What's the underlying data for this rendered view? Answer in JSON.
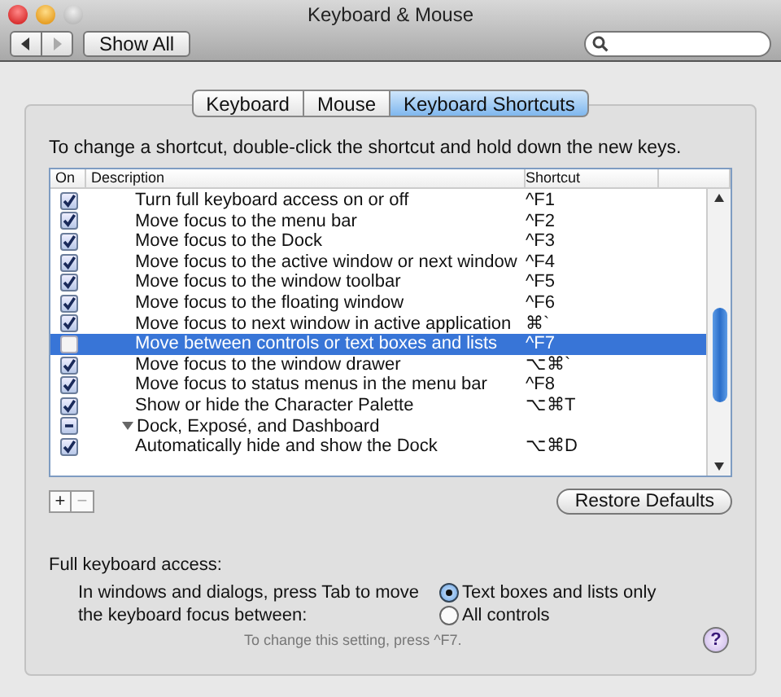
{
  "window": {
    "title": "Keyboard & Mouse"
  },
  "toolbar": {
    "show_all": "Show All"
  },
  "tabs": [
    {
      "label": "Keyboard",
      "selected": false
    },
    {
      "label": "Mouse",
      "selected": false
    },
    {
      "label": "Keyboard Shortcuts",
      "selected": true
    }
  ],
  "instruction": "To change a shortcut, double-click the shortcut and hold down the new keys.",
  "table": {
    "columns": [
      "On",
      "Description",
      "Shortcut"
    ],
    "rows": [
      {
        "kind": "item",
        "checked": true,
        "description": "Turn full keyboard access on or off",
        "shortcut": "^F1",
        "selected": false
      },
      {
        "kind": "item",
        "checked": true,
        "description": "Move focus to the menu bar",
        "shortcut": "^F2",
        "selected": false
      },
      {
        "kind": "item",
        "checked": true,
        "description": "Move focus to the Dock",
        "shortcut": "^F3",
        "selected": false
      },
      {
        "kind": "item",
        "checked": true,
        "description": "Move focus to the active window or next window",
        "shortcut": "^F4",
        "selected": false
      },
      {
        "kind": "item",
        "checked": true,
        "description": "Move focus to the window toolbar",
        "shortcut": "^F5",
        "selected": false
      },
      {
        "kind": "item",
        "checked": true,
        "description": "Move focus to the floating window",
        "shortcut": "^F6",
        "selected": false
      },
      {
        "kind": "item",
        "checked": true,
        "description": "Move focus to next window in active application",
        "shortcut": "⌘`",
        "selected": false
      },
      {
        "kind": "item",
        "checked": false,
        "description": "Move between controls or text boxes and lists",
        "shortcut": "^F7",
        "selected": true
      },
      {
        "kind": "item",
        "checked": true,
        "description": "Move focus to the window drawer",
        "shortcut": "⌥⌘`",
        "selected": false
      },
      {
        "kind": "item",
        "checked": true,
        "description": "Move focus to status menus in the menu bar",
        "shortcut": "^F8",
        "selected": false
      },
      {
        "kind": "item",
        "checked": true,
        "description": "Show or hide the Character Palette",
        "shortcut": "⌥⌘T",
        "selected": false
      },
      {
        "kind": "group",
        "mixed": true,
        "description": "Dock, Exposé, and Dashboard",
        "expanded": true,
        "selected": false
      },
      {
        "kind": "item",
        "checked": true,
        "description": "Automatically hide and show the Dock",
        "shortcut": "⌥⌘D",
        "selected": false
      }
    ]
  },
  "add_button": "+",
  "remove_button": "−",
  "restore_button": "Restore Defaults",
  "access": {
    "heading": "Full keyboard access:",
    "prompt": "In windows and dialogs, press Tab to move the keyboard focus between:",
    "options": [
      {
        "label": "Text boxes and lists only",
        "selected": true
      },
      {
        "label": "All controls",
        "selected": false
      }
    ],
    "hint": "To change this setting, press ^F7."
  },
  "help_button": "?"
}
